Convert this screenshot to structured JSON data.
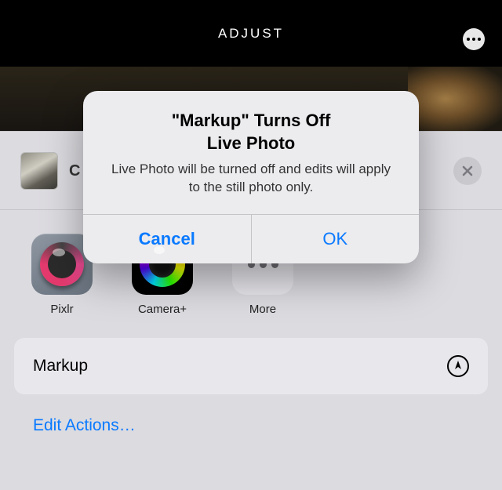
{
  "topbar": {
    "title": "ADJUST",
    "more_icon": "more-icon"
  },
  "sheet": {
    "close_icon": "close-icon",
    "apps": {
      "pixlr": "Pixlr",
      "cameraplus": "Camera+",
      "more": "More"
    },
    "actions": {
      "markup": "Markup",
      "edit_actions": "Edit Actions…"
    }
  },
  "alert": {
    "title_line1": "\"Markup\" Turns Off",
    "title_line2": "Live Photo",
    "message": "Live Photo will be turned off and edits will apply to the still photo only.",
    "cancel": "Cancel",
    "ok": "OK"
  },
  "colors": {
    "accent": "#0a7aff"
  }
}
